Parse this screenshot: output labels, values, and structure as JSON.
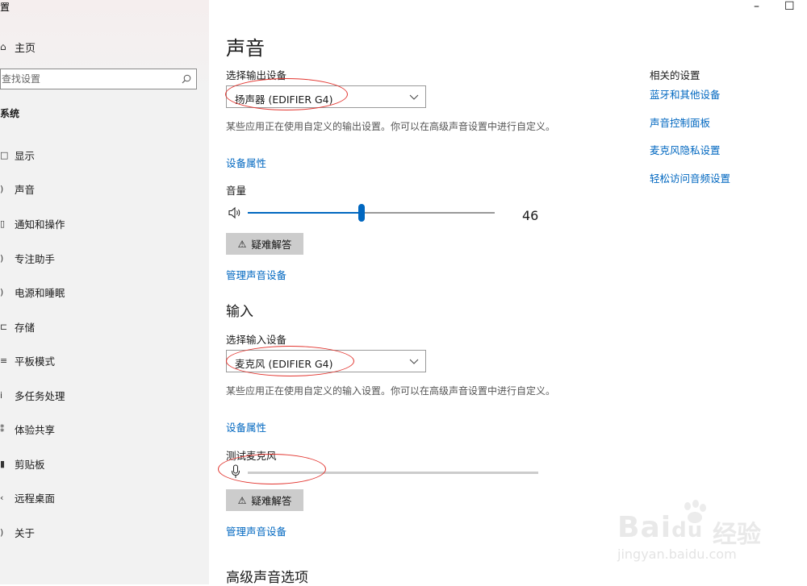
{
  "window": {
    "title_fragment": "置",
    "minimize_glyph": "–",
    "maximize_glyph": "☐"
  },
  "sidebar": {
    "home": {
      "icon": "home-icon",
      "label": "主页"
    },
    "search": {
      "placeholder": "查找设置"
    },
    "section_label": "系统",
    "items": [
      {
        "icon": "display-icon",
        "label": "显示"
      },
      {
        "icon": "sound-icon",
        "label": "声音"
      },
      {
        "icon": "notification-icon",
        "label": "通知和操作"
      },
      {
        "icon": "focus-assist-icon",
        "label": "专注助手"
      },
      {
        "icon": "power-icon",
        "label": "电源和睡眠"
      },
      {
        "icon": "storage-icon",
        "label": "存储"
      },
      {
        "icon": "tablet-icon",
        "label": "平板模式"
      },
      {
        "icon": "multitasking-icon",
        "label": "多任务处理"
      },
      {
        "icon": "shared-experience-icon",
        "label": "体验共享"
      },
      {
        "icon": "clipboard-icon",
        "label": "剪贴板"
      },
      {
        "icon": "remote-desktop-icon",
        "label": "远程桌面"
      },
      {
        "icon": "about-icon",
        "label": "关于"
      }
    ]
  },
  "main": {
    "title": "声音",
    "output": {
      "select_label": "选择输出设备",
      "device": "扬声器 (EDIFIER G4)",
      "description": "某些应用正在使用自定义的输出设置。你可以在高级声音设置中进行自定义。",
      "properties_link": "设备属性",
      "volume_label": "音量",
      "volume": 46,
      "volume_text": "46",
      "troubleshoot": "疑难解答",
      "manage_link": "管理声音设备"
    },
    "input": {
      "heading": "输入",
      "select_label": "选择输入设备",
      "device": "麦克风 (EDIFIER G4)",
      "description": "某些应用正在使用自定义的输入设置。你可以在高级声音设置中进行自定义。",
      "properties_link": "设备属性",
      "test_label": "测试麦克风",
      "mic_level": 0,
      "troubleshoot": "疑难解答",
      "manage_link": "管理声音设备"
    },
    "advanced_heading": "高级声音选项"
  },
  "related": {
    "title": "相关的设置",
    "links": [
      "蓝牙和其他设备",
      "声音控制面板",
      "麦克风隐私设置",
      "轻松访问音频设置"
    ]
  },
  "watermark": {
    "brand": "Bai",
    "brand2": "du",
    "cn": "经验",
    "url": "jingyan.baidu.com"
  },
  "colors": {
    "accent": "#0067c0",
    "annotation": "#e2342e",
    "sidebar_bg": "#f2f2f2"
  }
}
